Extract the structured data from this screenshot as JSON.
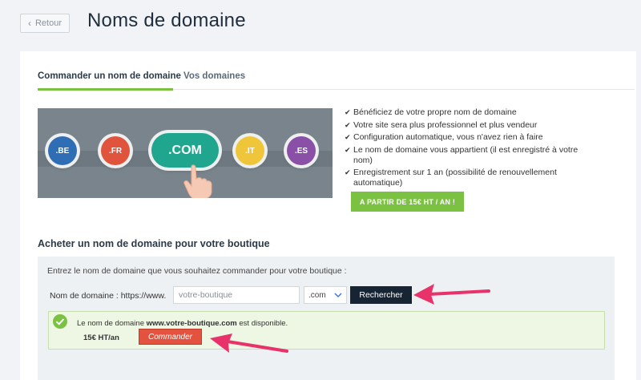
{
  "header": {
    "back_label": "Retour",
    "title": "Noms de domaine"
  },
  "tabs": [
    {
      "label": "Commander un nom de domaine",
      "active": true
    },
    {
      "label": "Vos domaines",
      "active": false
    }
  ],
  "hero": {
    "bubbles": [
      {
        "label": ".BE",
        "color": "#2f6db4"
      },
      {
        "label": ".FR",
        "color": "#e0533d"
      },
      {
        "label": ".COM",
        "color": "#20a68e"
      },
      {
        "label": ".IT",
        "color": "#efc53a"
      },
      {
        "label": ".ES",
        "color": "#8a4fa7"
      }
    ]
  },
  "features": [
    "Bénéficiez de votre propre nom de domaine",
    "Votre site sera plus professionnel et plus vendeur",
    "Configuration automatique, vous n'avez rien à faire",
    "Le nom de domaine vous appartient (il est enregistré à votre nom)",
    "Enregistrement sur 1 an (possibilité de renouvellement automatique)"
  ],
  "cta_label": "A PARTIR DE 15€ HT / AN !",
  "buy_section": {
    "title": "Acheter un nom de domaine pour votre boutique",
    "intro": "Entrez le nom de domaine que vous souhaitez commander pour votre boutique :",
    "domain_label": "Nom de domaine : https://www.",
    "input_value": "",
    "input_placeholder": "votre-boutique",
    "tld_selected": ".com",
    "search_label": "Rechercher"
  },
  "result": {
    "prefix": "Le nom de domaine",
    "domain": "www.votre-boutique.com",
    "suffix": "est disponible.",
    "price": "15€ HT/an",
    "order_label": "Commander"
  },
  "colors": {
    "accent_green": "#7cc242",
    "dark_navy": "#162433",
    "order_red": "#e2523f",
    "annotation_pink": "#e8336a"
  }
}
